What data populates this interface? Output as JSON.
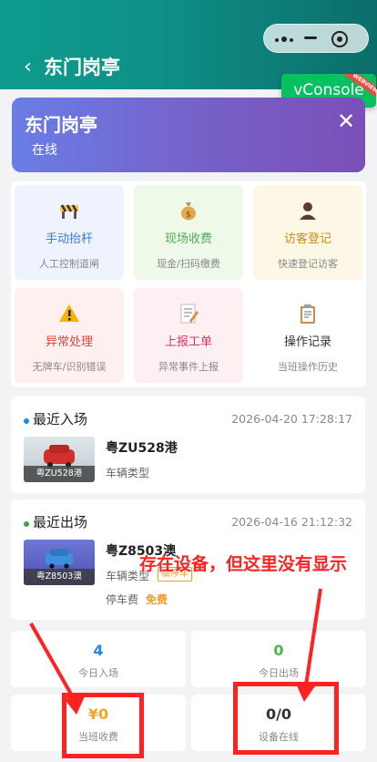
{
  "header": {
    "back_glyph": "‹",
    "title": "东门岗亭"
  },
  "vconsole": {
    "label": "vConsole",
    "ribbon": "WEBVIEW"
  },
  "gate": {
    "name": "东门岗亭",
    "status": "在线"
  },
  "actions": [
    {
      "title": "手动抬杆",
      "subtitle": "人工控制道闸",
      "icon": "barrier-icon",
      "color": "#3a7bd5",
      "bg": "#eef3fd"
    },
    {
      "title": "现场收费",
      "subtitle": "现金/扫码缴费",
      "icon": "money-bag-icon",
      "color": "#4caf50",
      "bg": "#eef9ea"
    },
    {
      "title": "访客登记",
      "subtitle": "快速登记访客",
      "icon": "person-icon",
      "color": "#d08a1f",
      "bg": "#fdf7e6"
    },
    {
      "title": "异常处理",
      "subtitle": "无牌车/识别错误",
      "icon": "warning-icon",
      "color": "#e0443a",
      "bg": "#fdf0ef"
    },
    {
      "title": "上报工单",
      "subtitle": "异常事件上报",
      "icon": "memo-icon",
      "color": "#d8336c",
      "bg": "#fdf0f3"
    },
    {
      "title": "操作记录",
      "subtitle": "当班操作历史",
      "icon": "clipboard-icon",
      "color": "#333333",
      "bg": "#ffffff"
    }
  ],
  "entry": {
    "heading": "最近入场",
    "time": "2026-04-20 17:28:17",
    "thumb_caption": "粤ZU528港",
    "plate": "粤ZU528港",
    "type_label": "车辆类型",
    "dot_color": "#1e88e5"
  },
  "exit": {
    "heading": "最近出场",
    "time": "2026-04-16 21:12:32",
    "thumb_caption": "粤Z8503澳",
    "plate": "粤Z8503澳",
    "type_label": "车辆类型",
    "tag": "临停车",
    "fee_label": "停车费",
    "fee_value": "免费",
    "dot_color": "#43a047"
  },
  "stats": [
    {
      "value": "4",
      "label": "今日入场",
      "color": "#2a85e6"
    },
    {
      "value": "0",
      "label": "今日出场",
      "color": "#46b94a"
    },
    {
      "value": "¥0",
      "label": "当班收费",
      "color": "#f5a623"
    },
    {
      "value": "0/0",
      "label": "设备在线",
      "color": "#333333"
    }
  ],
  "annotation": {
    "text": "存在设备，但这里没有显示",
    "color": "#ff2222"
  }
}
